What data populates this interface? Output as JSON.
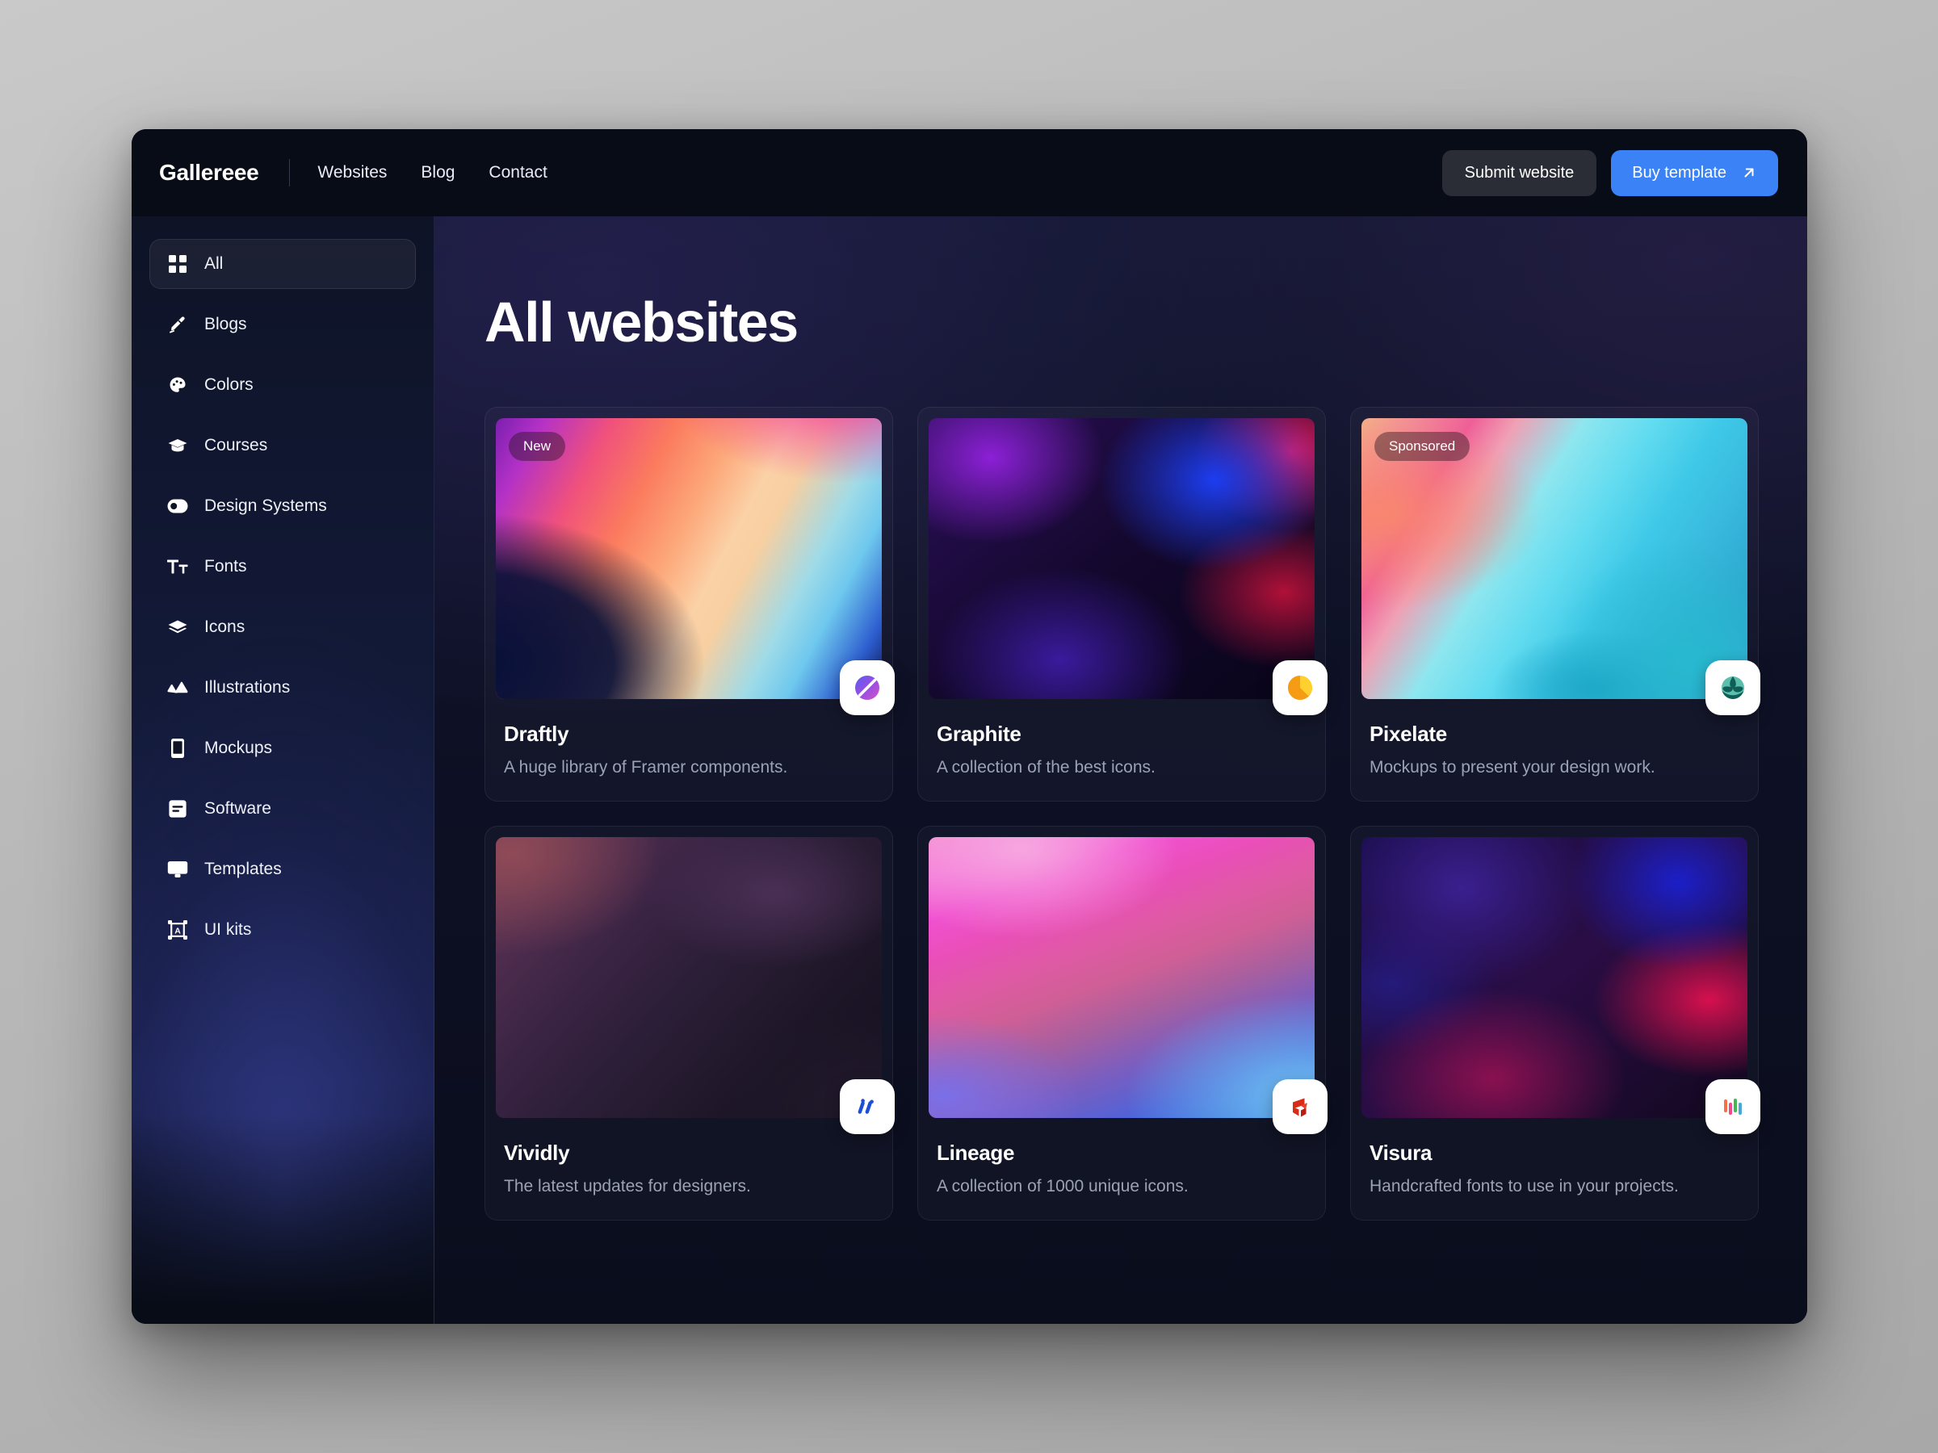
{
  "header": {
    "brand": "Gallereee",
    "nav": [
      {
        "label": "Websites"
      },
      {
        "label": "Blog"
      },
      {
        "label": "Contact"
      }
    ],
    "submit_label": "Submit website",
    "buy_label": "Buy template",
    "accent_color": "#3b82f6"
  },
  "sidebar": {
    "items": [
      {
        "label": "All",
        "icon": "grid-icon",
        "active": true
      },
      {
        "label": "Blogs",
        "icon": "pen-icon",
        "active": false
      },
      {
        "label": "Colors",
        "icon": "palette-icon",
        "active": false
      },
      {
        "label": "Courses",
        "icon": "graduation-cap-icon",
        "active": false
      },
      {
        "label": "Design Systems",
        "icon": "toggle-icon",
        "active": false
      },
      {
        "label": "Fonts",
        "icon": "text-size-icon",
        "active": false
      },
      {
        "label": "Icons",
        "icon": "layers-icon",
        "active": false
      },
      {
        "label": "Illustrations",
        "icon": "mountains-icon",
        "active": false
      },
      {
        "label": "Mockups",
        "icon": "phone-icon",
        "active": false
      },
      {
        "label": "Software",
        "icon": "window-icon",
        "active": false
      },
      {
        "label": "Templates",
        "icon": "monitor-icon",
        "active": false
      },
      {
        "label": "UI kits",
        "icon": "frame-a-icon",
        "active": false
      }
    ]
  },
  "main": {
    "title": "All websites",
    "cards": [
      {
        "title": "Draftly",
        "description": "A huge library of Framer components.",
        "badge": "New",
        "logo": "draftly-logo-icon",
        "thumb_class": "g-draftly"
      },
      {
        "title": "Graphite",
        "description": "A collection of the best icons.",
        "badge": "",
        "logo": "graphite-logo-icon",
        "thumb_class": "g-graphite"
      },
      {
        "title": "Pixelate",
        "description": "Mockups to present your design work.",
        "badge": "Sponsored",
        "logo": "pixelate-logo-icon",
        "thumb_class": "g-pixelate"
      },
      {
        "title": "Vividly",
        "description": "The latest updates for designers.",
        "badge": "",
        "logo": "vividly-logo-icon",
        "thumb_class": "g-vividly"
      },
      {
        "title": "Lineage",
        "description": "A collection of 1000 unique icons.",
        "badge": "",
        "logo": "lineage-logo-icon",
        "thumb_class": "g-lineage"
      },
      {
        "title": "Visura",
        "description": "Handcrafted fonts to use in your projects.",
        "badge": "",
        "logo": "visura-logo-icon",
        "thumb_class": "g-visura"
      }
    ]
  }
}
